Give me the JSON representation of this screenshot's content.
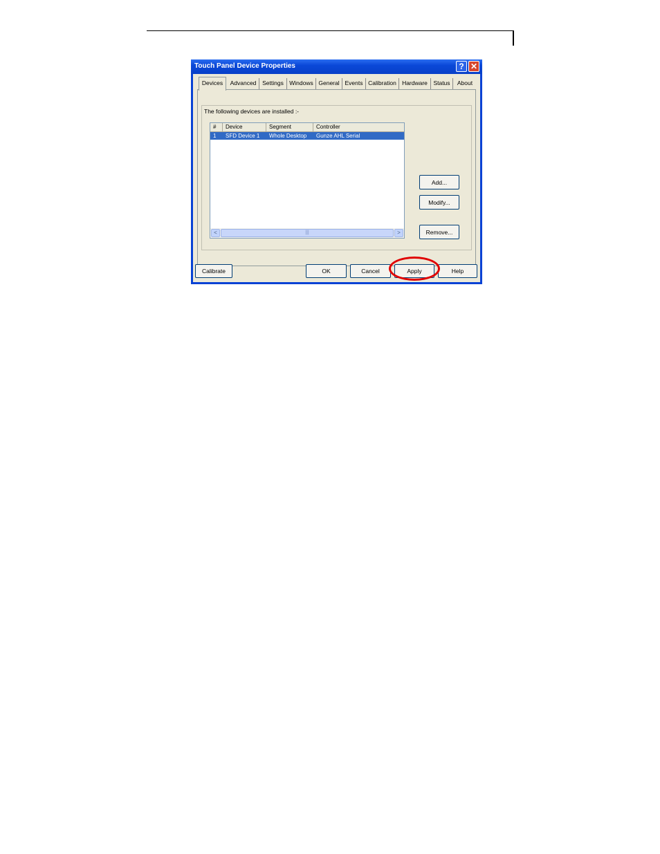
{
  "dialog": {
    "title": "Touch Panel Device Properties",
    "help_glyph": "?",
    "close_glyph": "✕"
  },
  "tabs": [
    "Devices",
    "Advanced",
    "Settings",
    "Windows",
    "General",
    "Events",
    "Calibration",
    "Hardware",
    "Status",
    "About"
  ],
  "panel": {
    "label": "The following devices are installed :-",
    "columns": [
      "#",
      "Device",
      "Segment",
      "Controller"
    ],
    "rows": [
      [
        "1",
        "SFD Device 1",
        "Whole Desktop",
        "Gunze AHL Serial"
      ]
    ],
    "scroll_left": "<",
    "scroll_right": ">",
    "scroll_grip": "|||",
    "add_label": "Add...",
    "modify_label": "Modify...",
    "remove_label": "Remove..."
  },
  "footer": {
    "calibrate_label": "Calibrate",
    "ok_label": "OK",
    "cancel_label": "Cancel",
    "apply_label": "Apply",
    "help_label": "Help"
  },
  "colors": {
    "selection": "#316ac5",
    "highlight_ring": "#e00000",
    "titlebar": "#0a48d8"
  }
}
